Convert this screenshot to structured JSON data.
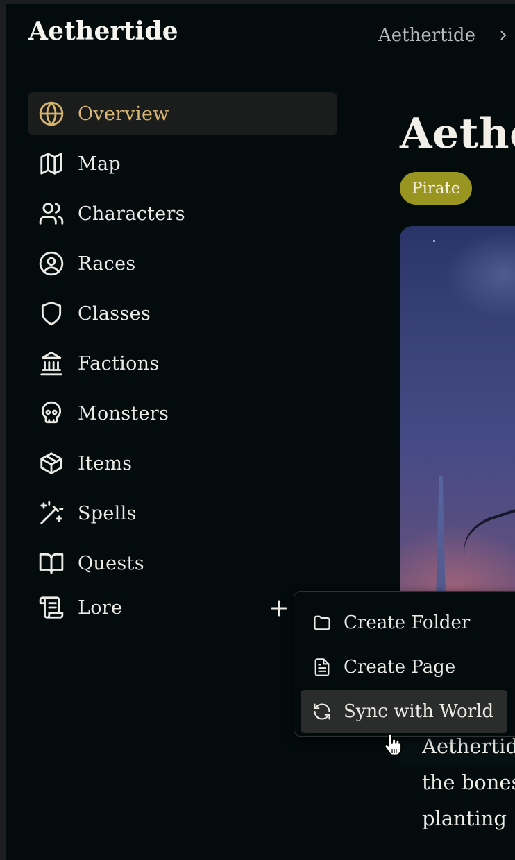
{
  "app": {
    "title": "Aethertide"
  },
  "breadcrumb": {
    "root": "Aethertide"
  },
  "sidebar": {
    "items": [
      {
        "label": "Overview",
        "icon": "globe-icon",
        "active": true
      },
      {
        "label": "Map",
        "icon": "map-icon"
      },
      {
        "label": "Characters",
        "icon": "users-icon"
      },
      {
        "label": "Races",
        "icon": "user-circle-icon"
      },
      {
        "label": "Classes",
        "icon": "shield-icon"
      },
      {
        "label": "Factions",
        "icon": "landmark-icon"
      },
      {
        "label": "Monsters",
        "icon": "skull-icon"
      },
      {
        "label": "Items",
        "icon": "package-icon"
      },
      {
        "label": "Spells",
        "icon": "wand-icon"
      },
      {
        "label": "Quests",
        "icon": "book-open-icon"
      },
      {
        "label": "Lore",
        "icon": "scroll-icon"
      }
    ],
    "add_icon": "plus-icon"
  },
  "page": {
    "title": "Aethertide",
    "tag": "Pirate",
    "description_lines": [
      "Aethertide",
      "the bones",
      "planting"
    ]
  },
  "menu": {
    "items": [
      {
        "label": "Create Folder",
        "icon": "folder-icon"
      },
      {
        "label": "Create Page",
        "icon": "file-text-icon"
      },
      {
        "label": "Sync with World",
        "icon": "refresh-icon",
        "hovered": true
      }
    ]
  },
  "colors": {
    "background": "#030b0c",
    "accent": "#d9b673",
    "tag": "#9a9520",
    "active_item": "#1a1d1c",
    "menu_hover": "#2b2d2d"
  }
}
